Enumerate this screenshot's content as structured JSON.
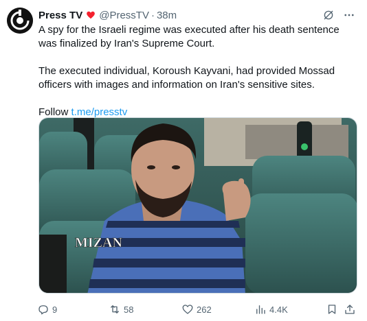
{
  "author": {
    "name": "Press TV",
    "handle": "@PressTV",
    "separator": "·",
    "time": "38m",
    "avatar_icon": "press-tv-logo",
    "badge_icon": "heart-icon",
    "badge_color": "#f4212e"
  },
  "tweet": {
    "line1": "A spy for the Israeli regime was executed after his death sentence was finalized by Iran's Supreme Court.",
    "line2": "The executed individual, Koroush Kayvani, had provided Mossad officers with images and information on Iran's sensitive sites.",
    "follow_prefix": "Follow ",
    "follow_link": "t.me/presstv"
  },
  "media": {
    "watermark": "MIZAN"
  },
  "actions": {
    "replies": "9",
    "reposts": "58",
    "likes": "262",
    "views": "4.4K"
  },
  "colors": {
    "link": "#1d9bf0",
    "muted": "#536471",
    "text": "#0f1419"
  }
}
